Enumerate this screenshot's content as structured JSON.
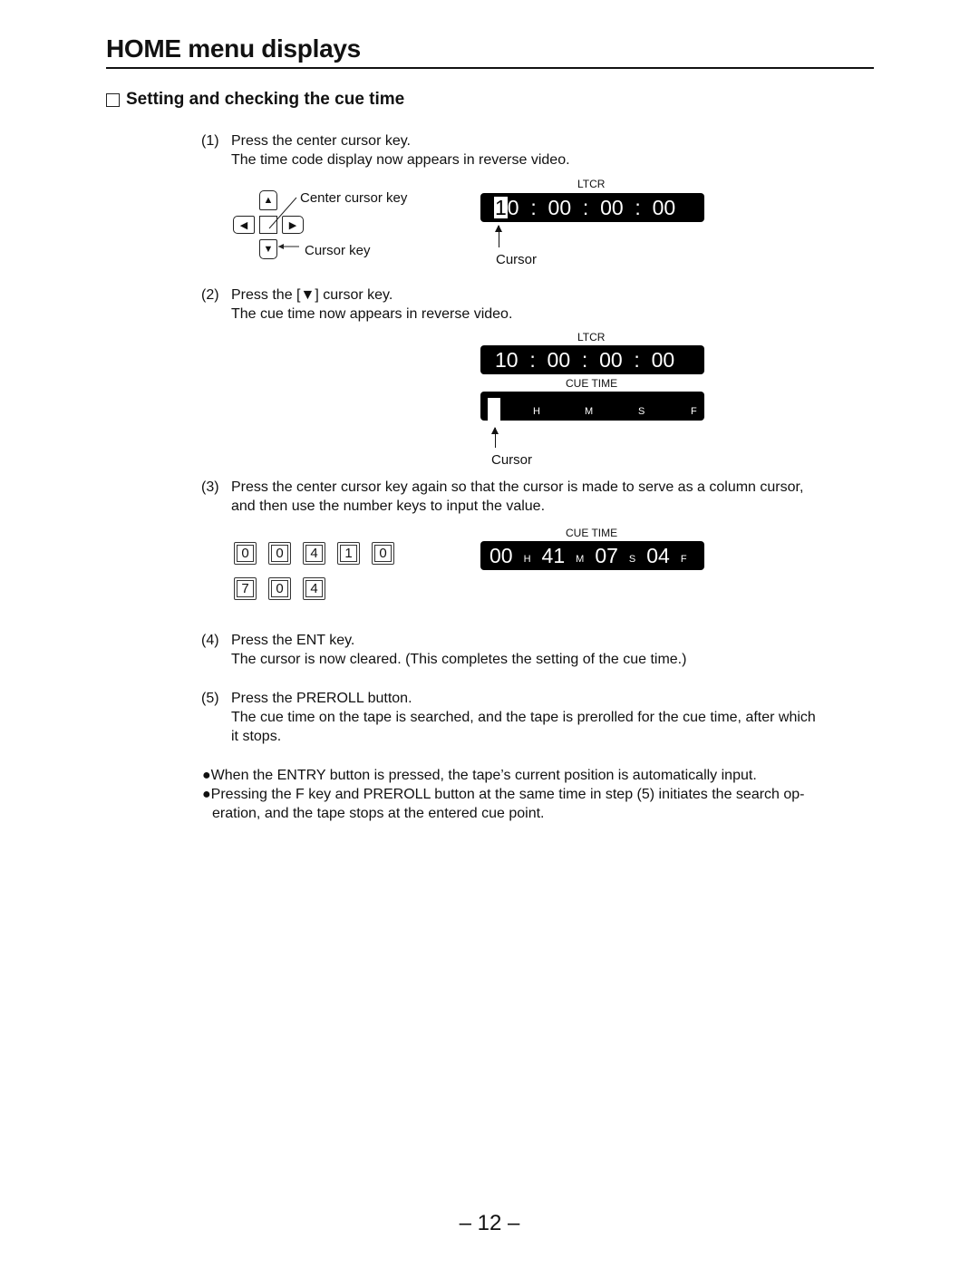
{
  "page": {
    "title": "HOME menu displays",
    "section_title": "Setting and checking the cue time",
    "page_number": "– 12 –"
  },
  "steps": [
    {
      "num": "(1)",
      "lines": [
        "Press the center cursor key.",
        "The time code display now appears in reverse video."
      ]
    },
    {
      "num": "(2)",
      "lines": [
        "Press the [",
        "▼",
        "] cursor key.",
        "The cue time now appears in reverse video."
      ]
    },
    {
      "num": "(3)",
      "lines": [
        "Press the center cursor key again so that the cursor is made to serve as a column cursor,",
        "and then use the number keys to input the value."
      ]
    },
    {
      "num": "(4)",
      "lines": [
        "Press the ENT key.",
        "The cursor is now cleared. (This completes the setting of the cue time.)"
      ]
    },
    {
      "num": "(5)",
      "lines": [
        "Press the PREROLL button.",
        "The cue time on the tape is searched, and the tape is prerolled for the cue time, after which",
        "it stops."
      ]
    }
  ],
  "notes": [
    "●When the ENTRY button is pressed, the tape’s current position is automatically input.",
    "●Pressing the F key and PREROLL button at the same time in step (5) initiates the search op-",
    "eration, and the tape stops at the entered cue point."
  ],
  "cursor_keys_diagram": {
    "center_label": "Center cursor key",
    "cursor_label": "Cursor key",
    "icons": {
      "up": "▲",
      "down": "▼",
      "left": "◀",
      "right": "▶"
    }
  },
  "display1": {
    "label": "LTCR",
    "cursor_digit": "1",
    "timecode_rest": "0  :  00  :  00  :  00",
    "cursor_label": "Cursor"
  },
  "display2": {
    "label": "LTCR",
    "timecode": "10  :  00  :  00  :  00",
    "cue_label": "CUE TIME",
    "units": [
      "H",
      "M",
      "S",
      "F"
    ],
    "cursor_label": "Cursor"
  },
  "number_keys": {
    "row1": [
      "0",
      "0",
      "4",
      "1",
      "0"
    ],
    "row2": [
      "7",
      "0",
      "4"
    ]
  },
  "display3": {
    "cue_label": "CUE TIME",
    "values": [
      {
        "value": "00",
        "unit": "H"
      },
      {
        "value": "41",
        "unit": "M"
      },
      {
        "value": "07",
        "unit": "S"
      },
      {
        "value": "04",
        "unit": "F"
      }
    ]
  }
}
